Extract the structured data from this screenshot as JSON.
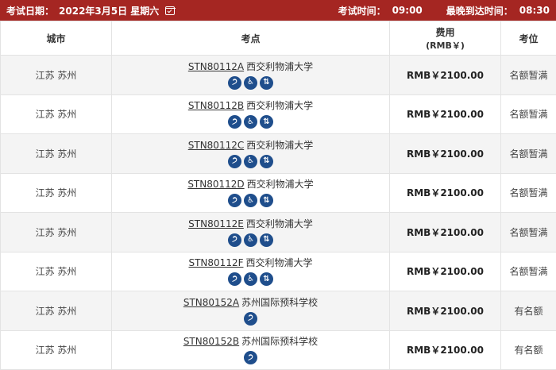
{
  "header": {
    "date_label": "考试日期：",
    "date_value": "2022年3月5日 星期六",
    "time_label": "考试时间：",
    "time_value": "09:00",
    "latest_label": "最晚到达时间：",
    "latest_value": "08:30"
  },
  "columns": {
    "city": "城市",
    "location": "考点",
    "fee": "费用",
    "fee_unit": "(RMB￥)",
    "seat": "考位"
  },
  "rows": [
    {
      "city": "江苏 苏州",
      "code": "STN80112A",
      "name": "西交利物浦大学",
      "icons": [
        "ear-icon",
        "wheelchair-icon",
        "elevator-icon"
      ],
      "fee": "RMB￥2100.00",
      "seat": "名额暂满"
    },
    {
      "city": "江苏 苏州",
      "code": "STN80112B",
      "name": "西交利物浦大学",
      "icons": [
        "ear-icon",
        "wheelchair-icon",
        "elevator-icon"
      ],
      "fee": "RMB￥2100.00",
      "seat": "名额暂满"
    },
    {
      "city": "江苏 苏州",
      "code": "STN80112C",
      "name": "西交利物浦大学",
      "icons": [
        "ear-icon",
        "wheelchair-icon",
        "elevator-icon"
      ],
      "fee": "RMB￥2100.00",
      "seat": "名额暂满"
    },
    {
      "city": "江苏 苏州",
      "code": "STN80112D",
      "name": "西交利物浦大学",
      "icons": [
        "ear-icon",
        "wheelchair-icon",
        "elevator-icon"
      ],
      "fee": "RMB￥2100.00",
      "seat": "名额暂满"
    },
    {
      "city": "江苏 苏州",
      "code": "STN80112E",
      "name": "西交利物浦大学",
      "icons": [
        "ear-icon",
        "wheelchair-icon",
        "elevator-icon"
      ],
      "fee": "RMB￥2100.00",
      "seat": "名额暂满"
    },
    {
      "city": "江苏 苏州",
      "code": "STN80112F",
      "name": "西交利物浦大学",
      "icons": [
        "ear-icon",
        "wheelchair-icon",
        "elevator-icon"
      ],
      "fee": "RMB￥2100.00",
      "seat": "名额暂满"
    },
    {
      "city": "江苏 苏州",
      "code": "STN80152A",
      "name": "苏州国际预科学校",
      "icons": [
        "ear-icon"
      ],
      "fee": "RMB￥2100.00",
      "seat": "有名额"
    },
    {
      "city": "江苏 苏州",
      "code": "STN80152B",
      "name": "苏州国际预科学校",
      "icons": [
        "ear-icon"
      ],
      "fee": "RMB￥2100.00",
      "seat": "有名额"
    }
  ],
  "colors": {
    "header_bar": "#a52622",
    "icon_blue": "#1f4e8c",
    "row_alt": "#f4f4f4"
  }
}
